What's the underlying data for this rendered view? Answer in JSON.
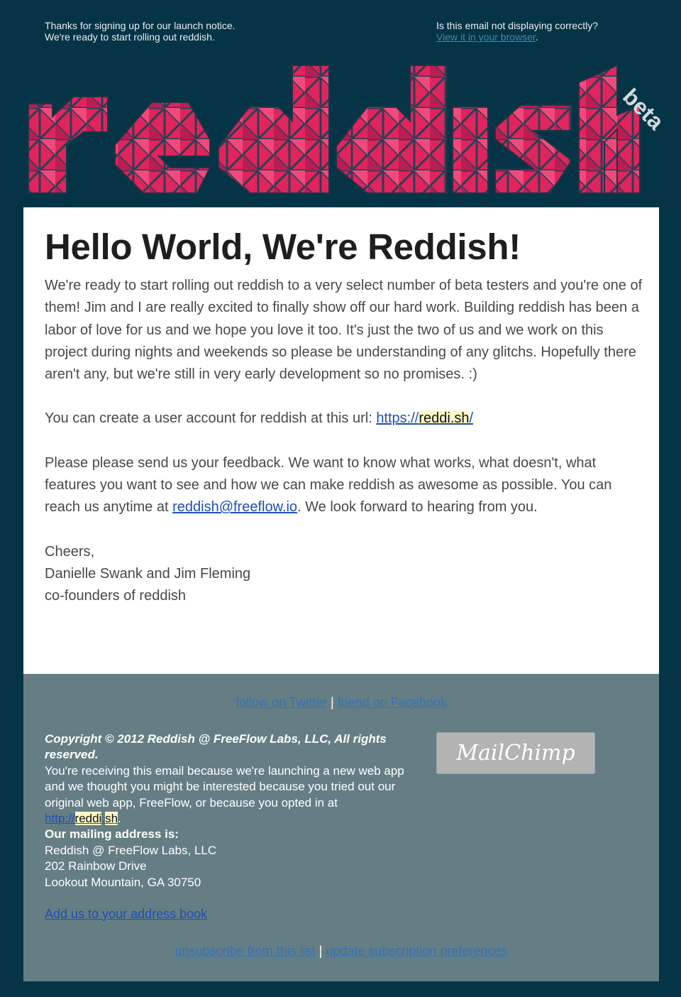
{
  "preheader": {
    "left_line1": "Thanks for signing up for our launch notice.",
    "left_line2": "We're ready to start rolling out reddish.",
    "right_line1": "Is this email not displaying correctly?",
    "right_link": "View it in your browser",
    "right_suffix": "."
  },
  "logo": {
    "badge": "beta",
    "primary_color": "#e0245e",
    "bg_color": "#053446"
  },
  "content": {
    "headline": "Hello World, We're Reddish!",
    "para1": "We're ready to start rolling out reddish to a very select number of beta testers and you're one of them! Jim and I are really excited to finally show off our hard work. Building reddish has been a labor of love for us and we hope you love it too. It's just the two of us and we work on this project during nights and weekends so please be understanding of any glitchs. Hopefully there aren't any, but we're still in very early development so no promises.  :)",
    "para2_prefix": "You can create a user account for reddish at this url: ",
    "url_a": "https://",
    "url_b": "reddi.sh",
    "url_c": "/",
    "para3_prefix": "Please please send us your feedback.  We want to know what works, what doesn't, what features you want to see and how we can make reddish as awesome as possible.  You can reach us anytime at ",
    "email": "reddish@freeflow.io",
    "para3_suffix": ".  We look forward to hearing from you.",
    "sign_cheers": "Cheers,",
    "sign_names": "Danielle Swank and Jim Fleming",
    "sign_title": "co-founders of reddish"
  },
  "footer": {
    "twitter": "follow on Twitter",
    "separator": "|",
    "facebook": "friend on Facebook",
    "copyright": "Copyright © 2012 Reddish @ FreeFlow Labs, LLC, All rights reserved.",
    "reason": "You're receiving this email because we're launching a new web app and we thought you might be interested because you tried out our original web app, FreeFlow, or because you opted in at",
    "link_a": "http://",
    "link_b": "reddi",
    "link_c": ".",
    "link_d": "sh",
    "link_suffix": ".",
    "mailing_label": "Our mailing address is:",
    "addr1": "Reddish @ FreeFlow Labs, LLC",
    "addr2": "202 Rainbow Drive",
    "addr3": "Lookout Mountain, GA 30750",
    "address_book": "Add us to your address book",
    "mailchimp": "MailChimp",
    "unsubscribe": "unsubscribe from this list",
    "update_prefs": "update subscription preferences"
  }
}
